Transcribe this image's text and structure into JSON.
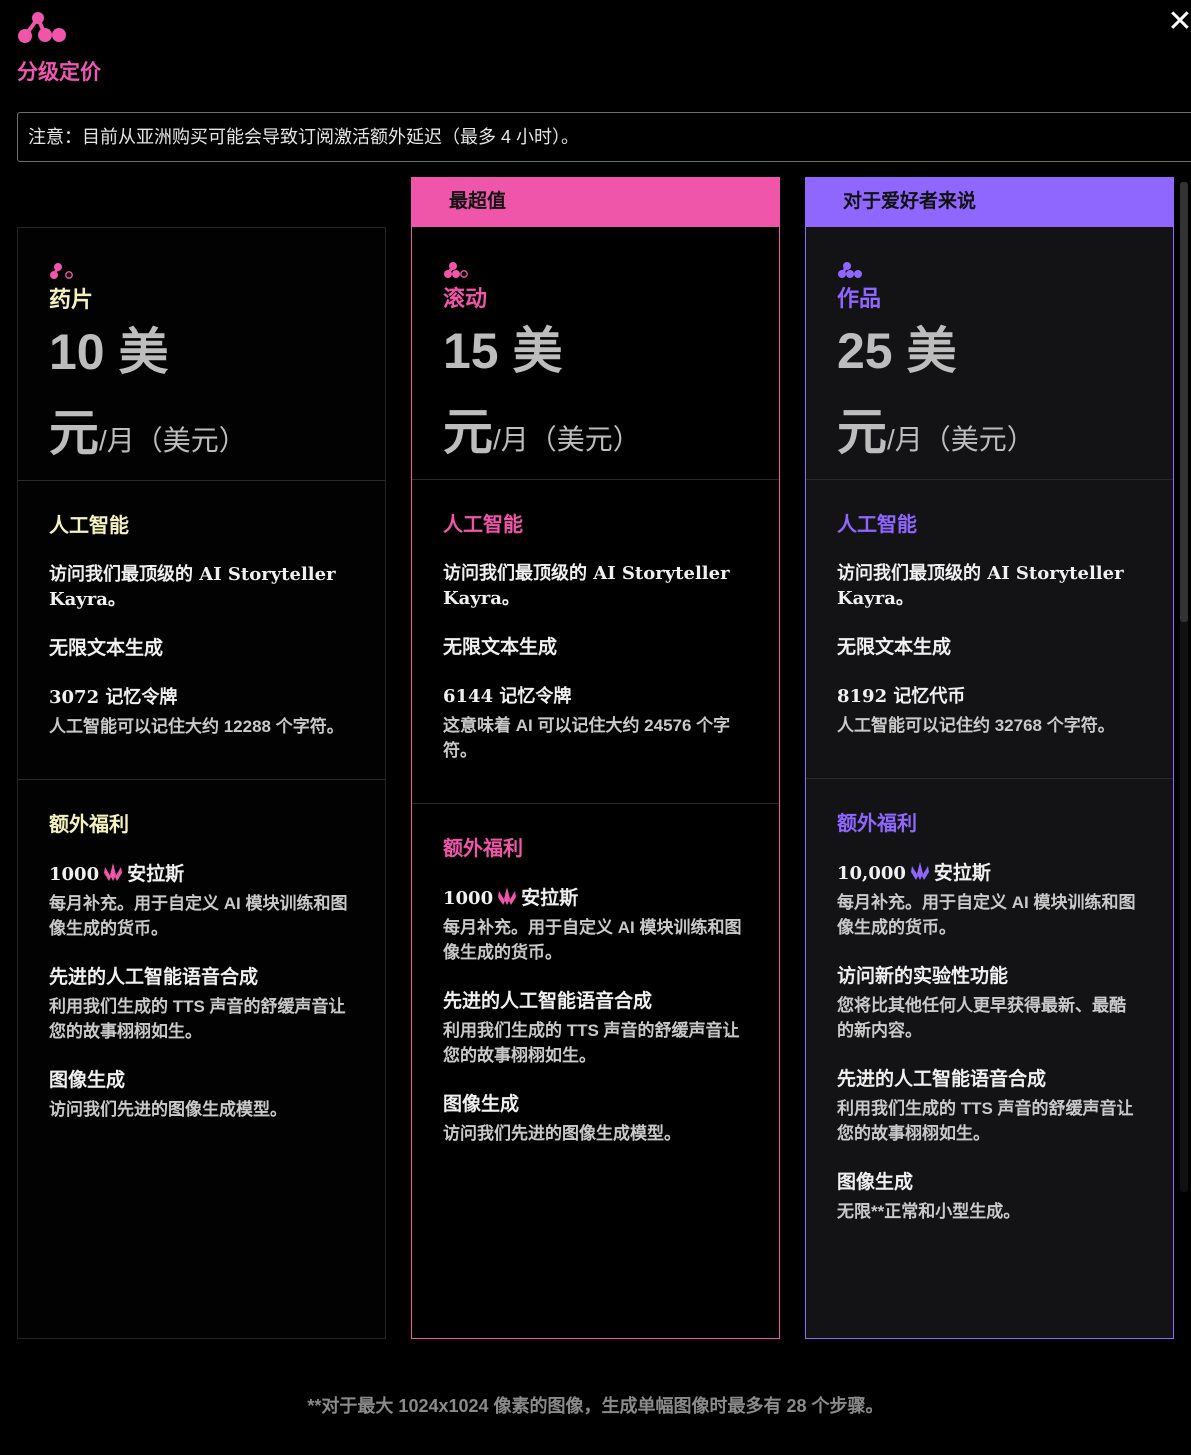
{
  "header": {
    "title": "分级定价",
    "close_symbol": "✕",
    "notice": "注意：目前从亚洲购买可能会导致订阅激活额外延迟（最多 4 小时）。"
  },
  "colors": {
    "pink": "#ef56a9",
    "purple": "#8f67ff",
    "yellow": "#f5f2bd",
    "background": "#000000"
  },
  "tiers": [
    {
      "badge": "",
      "name": "药片",
      "price": "10 美元",
      "price_unit": "/月（美元）",
      "ai_title": "人工智能",
      "ai_features": [
        {
          "title": "访问我们最顶级的 AI Storyteller Kayra。",
          "desc": ""
        },
        {
          "title": "无限文本生成",
          "desc": ""
        },
        {
          "title": "3072 记忆令牌",
          "desc": "人工智能可以记住大约 12288 个字符。"
        }
      ],
      "perks_title": "额外福利",
      "anlas_amount": "1000",
      "anlas_label": "安拉斯",
      "anlas_desc": "每月补充。用于自定义 AI 模块训练和图像生成的货币。",
      "perks": [
        {
          "title": "先进的人工智能语音合成",
          "desc": "利用我们生成的 TTS 声音的舒缓声音让您的故事栩栩如生。"
        },
        {
          "title": "图像生成",
          "desc": "访问我们先进的图像生成模型。"
        }
      ]
    },
    {
      "badge": "最超值",
      "name": "滚动",
      "price": "15 美元",
      "price_unit": "/月（美元）",
      "ai_title": "人工智能",
      "ai_features": [
        {
          "title": "访问我们最顶级的 AI Storyteller Kayra。",
          "desc": ""
        },
        {
          "title": "无限文本生成",
          "desc": ""
        },
        {
          "title": "6144 记忆令牌",
          "desc": "这意味着 AI 可以记住大约 24576 个字符。"
        }
      ],
      "perks_title": "额外福利",
      "anlas_amount": "1000",
      "anlas_label": "安拉斯",
      "anlas_desc": "每月补充。用于自定义 AI 模块训练和图像生成的货币。",
      "perks": [
        {
          "title": "先进的人工智能语音合成",
          "desc": "利用我们生成的 TTS 声音的舒缓声音让您的故事栩栩如生。"
        },
        {
          "title": "图像生成",
          "desc": "访问我们先进的图像生成模型。"
        }
      ]
    },
    {
      "badge": "对于爱好者来说",
      "name": "作品",
      "price": "25 美元",
      "price_unit": "/月（美元）",
      "ai_title": "人工智能",
      "ai_features": [
        {
          "title": "访问我们最顶级的 AI Storyteller Kayra。",
          "desc": ""
        },
        {
          "title": "无限文本生成",
          "desc": ""
        },
        {
          "title": "8192 记忆代币",
          "desc": "人工智能可以记住约 32768 个字符。"
        }
      ],
      "perks_title": "额外福利",
      "anlas_amount": "10,000",
      "anlas_label": "安拉斯",
      "anlas_desc": "每月补充。用于自定义 AI 模块训练和图像生成的货币。",
      "perks": [
        {
          "title": "访问新的实验性功能",
          "desc": "您将比其他任何人更早获得最新、最酷的新内容。"
        },
        {
          "title": "先进的人工智能语音合成",
          "desc": "利用我们生成的 TTS 声音的舒缓声音让您的故事栩栩如生。"
        },
        {
          "title": "图像生成",
          "desc": "无限**正常和小型生成。"
        }
      ]
    }
  ],
  "footnote": "**对于最大 1024x1024 像素的图像，生成单幅图像时最多有 28 个步骤。"
}
